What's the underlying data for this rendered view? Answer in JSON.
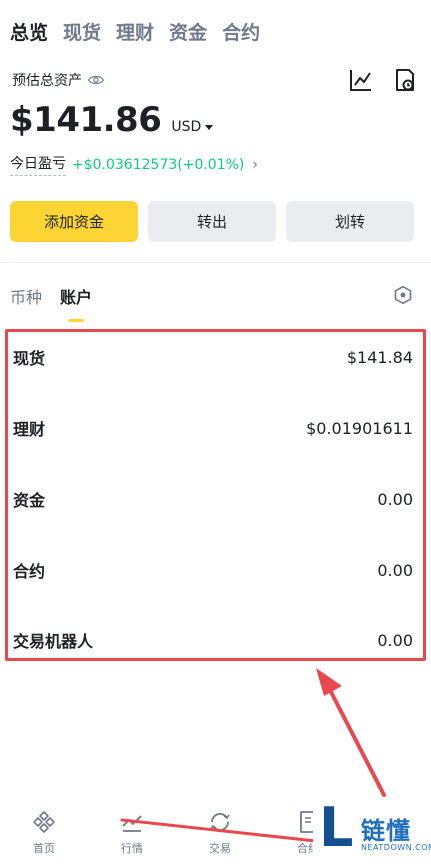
{
  "top_tabs": [
    "总览",
    "现货",
    "理财",
    "资金",
    "合约"
  ],
  "overview": {
    "estimated_label": "预估总资产",
    "balance": "$141.86",
    "currency": "USD",
    "pnl_label": "今日盈亏",
    "pnl_value": "+$0.03612573(+0.01%)"
  },
  "actions": {
    "add_funds": "添加资金",
    "transfer_out": "转出",
    "transfer": "划转"
  },
  "sub_tabs": [
    "币种",
    "账户"
  ],
  "accounts": [
    {
      "name": "现货",
      "value": "$141.84"
    },
    {
      "name": "理财",
      "value": "$0.01901611"
    },
    {
      "name": "资金",
      "value": "0.00"
    },
    {
      "name": "合约",
      "value": "0.00"
    },
    {
      "name": "交易机器人",
      "value": "0.00"
    }
  ],
  "bottom_nav": [
    "首页",
    "行情",
    "交易",
    "合约"
  ],
  "watermark": {
    "letter": "L",
    "cn": "链懂",
    "en": "NEATDOWN.COM"
  },
  "colors": {
    "accent": "#fcd535",
    "positive": "#0ecb81",
    "highlight_border": "#e8484e",
    "annotation_arrow": "#e8484e"
  }
}
